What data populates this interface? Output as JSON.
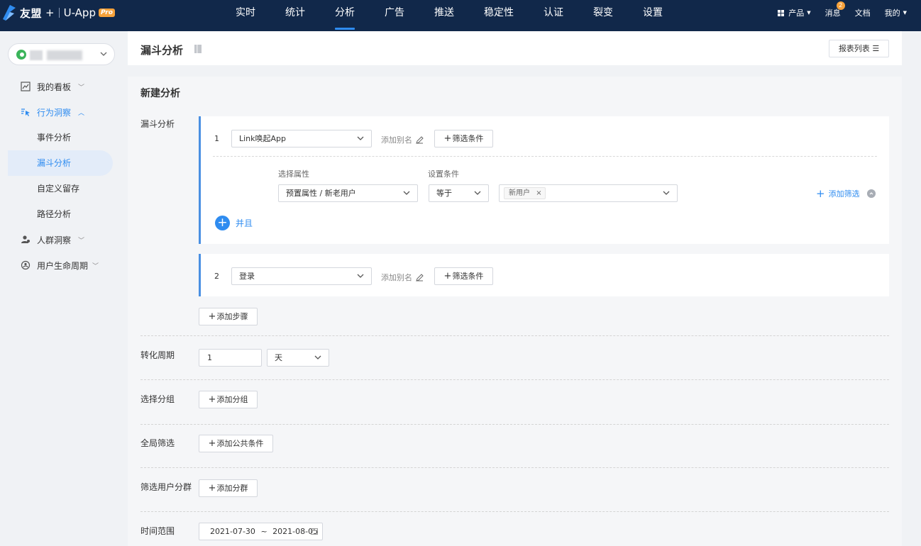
{
  "header": {
    "brand": "友盟",
    "plus": "+",
    "product": "U-App",
    "pro_badge": "Pro",
    "nav": [
      {
        "label": "实时"
      },
      {
        "label": "统计"
      },
      {
        "label": "分析",
        "active": true
      },
      {
        "label": "广告"
      },
      {
        "label": "推送"
      },
      {
        "label": "稳定性"
      },
      {
        "label": "认证"
      },
      {
        "label": "裂变"
      },
      {
        "label": "设置"
      }
    ],
    "right": {
      "products": "产品",
      "messages": "消息",
      "message_count": "2",
      "docs": "文档",
      "mine": "我的"
    },
    "colors": {
      "bar": "#11284a",
      "accent": "#2f8cf0",
      "badge": "#f7a23b"
    }
  },
  "sidebar": {
    "items": [
      {
        "label": "我的看板",
        "icon": "chart-line-icon"
      },
      {
        "label": "行为洞察",
        "icon": "cursor-click-icon",
        "open": true
      },
      {
        "label": "人群洞察",
        "icon": "user-group-icon"
      },
      {
        "label": "用户生命周期",
        "icon": "lifecycle-icon"
      }
    ],
    "sub_items": [
      {
        "label": "事件分析"
      },
      {
        "label": "漏斗分析",
        "active": true
      },
      {
        "label": "自定义留存"
      },
      {
        "label": "路径分析"
      }
    ]
  },
  "page": {
    "title": "漏斗分析",
    "report_list_label": "报表列表"
  },
  "form": {
    "section_title": "新建分析",
    "funnel_label": "漏斗分析",
    "steps": [
      {
        "index": "1",
        "event": "Link唤起App",
        "alias": "添加别名",
        "filter_btn": "筛选条件"
      },
      {
        "index": "2",
        "event": "登录",
        "alias": "添加别名",
        "filter_btn": "筛选条件"
      }
    ],
    "filter": {
      "property_label": "选择属性",
      "condition_label": "设置条件",
      "property_value": "预置属性 / 新老用户",
      "operator_value": "等于",
      "tag": "新用户",
      "add_filter": "添加筛选",
      "and_label": "并且"
    },
    "add_step": "添加步骤",
    "conversion": {
      "label": "转化周期",
      "value": "1",
      "unit": "天"
    },
    "grouping": {
      "label": "选择分组",
      "button": "添加分组"
    },
    "global_filter": {
      "label": "全局筛选",
      "button": "添加公共条件"
    },
    "segment": {
      "label": "筛选用户分群",
      "button": "添加分群"
    },
    "time_range": {
      "label": "时间范围",
      "start": "2021-07-30",
      "sep": "~",
      "end": "2021-08-05"
    }
  }
}
